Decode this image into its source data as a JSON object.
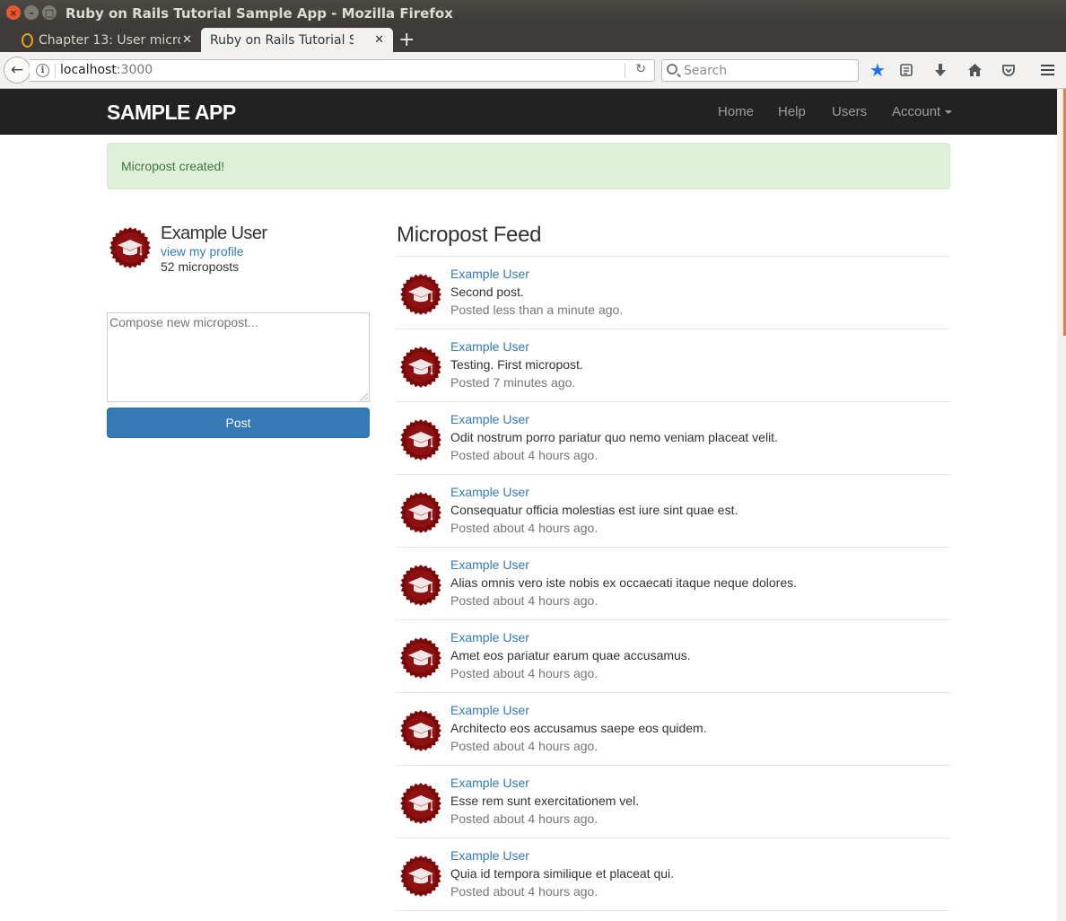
{
  "window": {
    "title": "Ruby on Rails Tutorial Sample App - Mozilla Firefox"
  },
  "tabs": [
    {
      "label": "Chapter 13: User micro",
      "active": false
    },
    {
      "label": "Ruby on Rails Tutorial Sam",
      "active": true
    }
  ],
  "toolbar": {
    "url_host": "localhost",
    "url_port": ":3000",
    "search_placeholder": "Search",
    "icons": [
      "back-icon",
      "info-icon",
      "reload-icon",
      "bookmark-star-icon",
      "reading-list-icon",
      "download-icon",
      "home-icon",
      "pocket-icon",
      "menu-icon"
    ]
  },
  "site": {
    "logo": "SAMPLE APP",
    "nav": {
      "home": "Home",
      "help": "Help",
      "users": "Users",
      "account": "Account"
    },
    "colors": {
      "header": "#222222",
      "link": "#337ab7",
      "alert_bg": "#dff0d8",
      "alert_text": "#3c763d",
      "button": "#337ab7"
    }
  },
  "alert": {
    "message": "Micropost created!"
  },
  "user_info": {
    "name": "Example User",
    "profile_link": "view my profile",
    "post_count": "52 microposts"
  },
  "composer": {
    "placeholder": "Compose new micropost...",
    "value": "",
    "submit_label": "Post"
  },
  "feed": {
    "title": "Micropost Feed",
    "items": [
      {
        "user": "Example User",
        "content": "Second post.",
        "timestamp": "Posted less than a minute ago."
      },
      {
        "user": "Example User",
        "content": "Testing. First micropost.",
        "timestamp": "Posted 7 minutes ago."
      },
      {
        "user": "Example User",
        "content": "Odit nostrum porro pariatur quo nemo veniam placeat velit.",
        "timestamp": "Posted about 4 hours ago."
      },
      {
        "user": "Example User",
        "content": "Consequatur officia molestias est iure sint quae est.",
        "timestamp": "Posted about 4 hours ago."
      },
      {
        "user": "Example User",
        "content": "Alias omnis vero iste nobis ex occaecati itaque neque dolores.",
        "timestamp": "Posted about 4 hours ago."
      },
      {
        "user": "Example User",
        "content": "Amet eos pariatur earum quae accusamus.",
        "timestamp": "Posted about 4 hours ago."
      },
      {
        "user": "Example User",
        "content": "Architecto eos accusamus saepe eos quidem.",
        "timestamp": "Posted about 4 hours ago."
      },
      {
        "user": "Example User",
        "content": "Esse rem sunt exercitationem vel.",
        "timestamp": "Posted about 4 hours ago."
      },
      {
        "user": "Example User",
        "content": "Quia id tempora similique et placeat qui.",
        "timestamp": "Posted about 4 hours ago."
      }
    ]
  }
}
